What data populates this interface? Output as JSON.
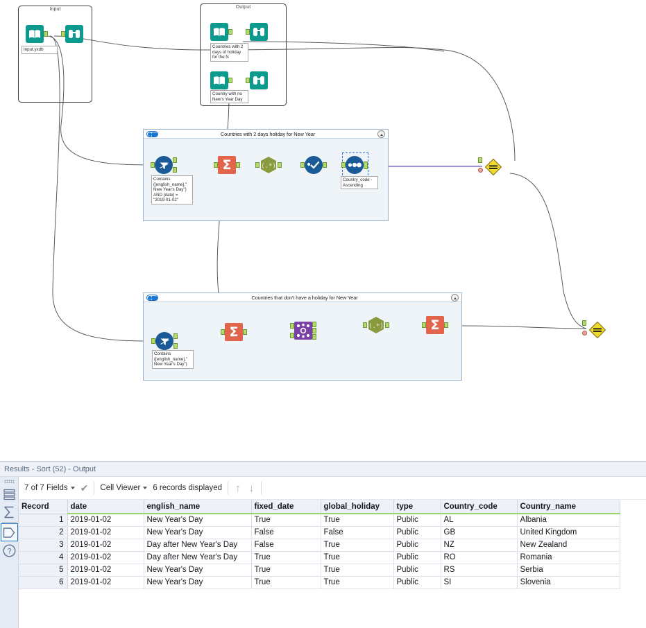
{
  "canvas": {
    "containers": [
      {
        "id": "input",
        "title": "Input"
      },
      {
        "id": "output",
        "title": "Output"
      }
    ],
    "workflow_containers": [
      {
        "id": "wc1",
        "title": "Countries with 2 days holiday for New Year"
      },
      {
        "id": "wc2",
        "title": "Countries that don't have a holiday for New Year"
      }
    ],
    "annotations": {
      "input_file": "Input.yxdb",
      "output_1": "Countries with 2\ndays of holiday\nfor the N",
      "output_2": "Country with no\nNew's Year Day",
      "filter_1": "Contains\n([english_name],\"\nNew Year's Day\")\nAND [date] =\n\"2019-01-02\"",
      "filter_2": "Contains\n([english_name],\"\nNew Year's Day\")",
      "sort_1": "Country_code -\nAscending"
    },
    "tools": {
      "input_data": "input-data-tool",
      "browse": "browse-tool",
      "filter": "filter-tool",
      "summarize": "summarize-tool",
      "regex": "regex-tool",
      "unique": "unique-tool",
      "sort": "sort-tool",
      "join": "join-tool",
      "container_link": "container-link-tool"
    },
    "colors": {
      "teal": "#0b9a8d",
      "summarize_red": "#e2644a",
      "regex_olive": "#8a9a3f",
      "blue": "#1a5a96",
      "join_purple": "#7b3fa8",
      "diamond_yellow": "#f2d82e",
      "container_fill": "#eef4f8",
      "port_green": "#b4d96c"
    }
  },
  "results": {
    "title": "Results - Sort (52) - Output",
    "toolbar": {
      "fields_label": "7 of 7 Fields",
      "check_icon": "✔",
      "viewer_label": "Cell Viewer",
      "records_label": "6 records displayed",
      "up_arrow": "↑",
      "down_arrow": "↓"
    },
    "sidebar": {
      "items": [
        {
          "name": "records-icon",
          "glyph": "rows",
          "active": false
        },
        {
          "name": "messages-icon",
          "glyph": "sigma",
          "active": false
        },
        {
          "name": "metadata-icon",
          "glyph": "tag",
          "active": true
        },
        {
          "name": "help-icon",
          "glyph": "question",
          "active": false
        }
      ]
    },
    "table": {
      "columns": [
        "Record",
        "date",
        "english_name",
        "fixed_date",
        "global_holiday",
        "type",
        "Country_code",
        "Country_name"
      ],
      "rows": [
        [
          "1",
          "2019-01-02",
          "New Year's Day",
          "True",
          "True",
          "Public",
          "AL",
          "Albania"
        ],
        [
          "2",
          "2019-01-02",
          "New Year's Day",
          "False",
          "False",
          "Public",
          "GB",
          "United Kingdom"
        ],
        [
          "3",
          "2019-01-02",
          "Day after New Year's Day",
          "False",
          "True",
          "Public",
          "NZ",
          "New Zealand"
        ],
        [
          "4",
          "2019-01-02",
          "Day after New Year's Day",
          "True",
          "True",
          "Public",
          "RO",
          "Romania"
        ],
        [
          "5",
          "2019-01-02",
          "New Year's Day",
          "True",
          "True",
          "Public",
          "RS",
          "Serbia"
        ],
        [
          "6",
          "2019-01-02",
          "New Year's Day",
          "True",
          "True",
          "Public",
          "SI",
          "Slovenia"
        ]
      ]
    }
  }
}
